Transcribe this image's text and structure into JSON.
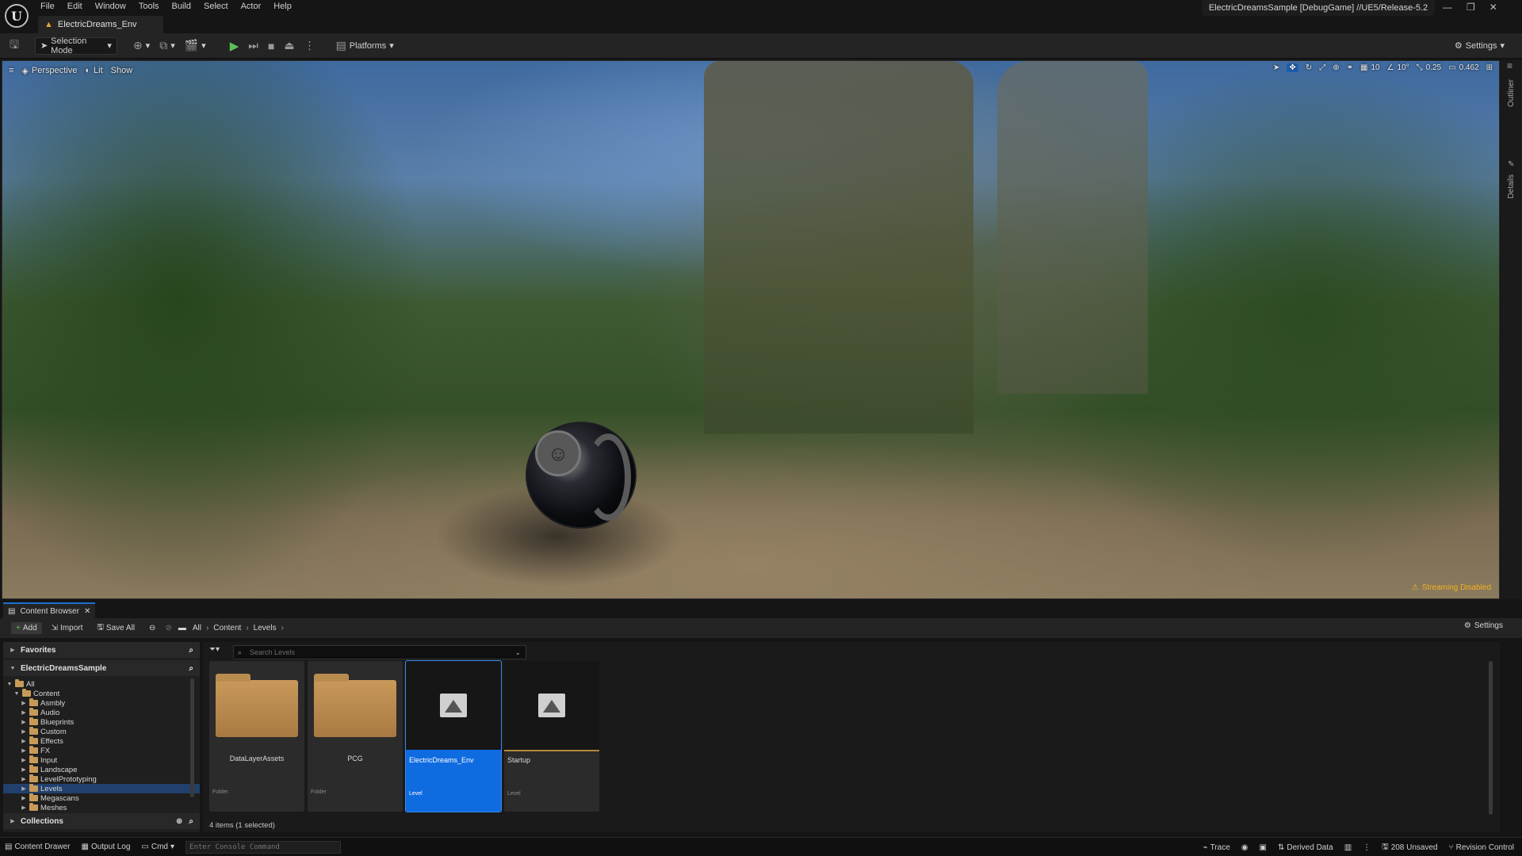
{
  "app": {
    "logo_glyph": "U",
    "menu": [
      "File",
      "Edit",
      "Window",
      "Tools",
      "Build",
      "Select",
      "Actor",
      "Help"
    ],
    "document_tab": "ElectricDreams_Env",
    "project_title": "ElectricDreamsSample [DebugGame] //UE5/Release-5.2",
    "accent_color": "#0f6be0"
  },
  "toolbar": {
    "selection_mode": "Selection Mode",
    "platforms": "Platforms",
    "settings": "Settings"
  },
  "viewport": {
    "perspective": "Perspective",
    "lit": "Lit",
    "show": "Show",
    "grid_snap": "10",
    "rotation_snap": "10°",
    "scale_snap": "0.25",
    "camera_speed": "0.462",
    "streaming_warning": "Streaming Disabled",
    "side_tabs": [
      "Outliner",
      "Details"
    ]
  },
  "content_browser": {
    "tab_label": "Content Browser",
    "add": "Add",
    "import": "Import",
    "save_all": "Save All",
    "breadcrumb": [
      "All",
      "Content",
      "Levels"
    ],
    "settings": "Settings",
    "search_placeholder": "Search Levels",
    "favorites": "Favorites",
    "project": "ElectricDreamsSample",
    "collections": "Collections",
    "tree": [
      {
        "label": "All",
        "depth": 0,
        "open": true
      },
      {
        "label": "Content",
        "depth": 1,
        "open": true
      },
      {
        "label": "Asmbly",
        "depth": 2
      },
      {
        "label": "Audio",
        "depth": 2
      },
      {
        "label": "Blueprints",
        "depth": 2
      },
      {
        "label": "Custom",
        "depth": 2
      },
      {
        "label": "Effects",
        "depth": 2
      },
      {
        "label": "FX",
        "depth": 2
      },
      {
        "label": "Input",
        "depth": 2
      },
      {
        "label": "Landscape",
        "depth": 2
      },
      {
        "label": "LevelPrototyping",
        "depth": 2
      },
      {
        "label": "Levels",
        "depth": 2,
        "selected": true
      },
      {
        "label": "Megascans",
        "depth": 2
      },
      {
        "label": "Meshes",
        "depth": 2
      }
    ],
    "assets": [
      {
        "name": "DataLayerAssets",
        "kind": "Folder",
        "type": "folder"
      },
      {
        "name": "PCG",
        "kind": "Folder",
        "type": "folder"
      },
      {
        "name": "ElectricDreams_Env",
        "kind": "Level",
        "type": "level",
        "selected": true
      },
      {
        "name": "Startup",
        "kind": "Level",
        "type": "level"
      }
    ],
    "items_count": "4 items (1 selected)"
  },
  "statusbar": {
    "content_drawer": "Content Drawer",
    "output_log": "Output Log",
    "cmd": "Cmd",
    "console_placeholder": "Enter Console Command",
    "trace": "Trace",
    "derived_data": "Derived Data",
    "unsaved": "208 Unsaved",
    "revision_control": "Revision Control"
  }
}
